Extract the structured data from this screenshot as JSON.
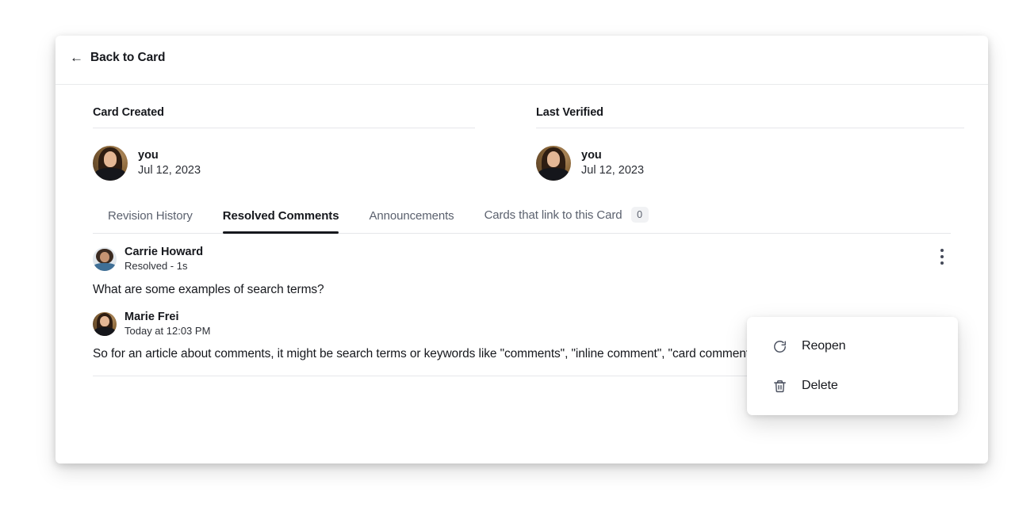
{
  "header": {
    "back_label": "Back to Card",
    "back_arrow": "←",
    "back_icon": "arrow-left-icon"
  },
  "meta": {
    "created": {
      "title": "Card Created",
      "who": "you",
      "date": "Jul 12, 2023"
    },
    "verified": {
      "title": "Last Verified",
      "who": "you",
      "date": "Jul 12, 2023"
    }
  },
  "tabs": [
    {
      "label": "Revision History",
      "active": false,
      "badge": null
    },
    {
      "label": "Resolved Comments",
      "active": true,
      "badge": null
    },
    {
      "label": "Announcements",
      "active": false,
      "badge": null
    },
    {
      "label": "Cards that link to this Card",
      "active": false,
      "badge": "0"
    }
  ],
  "comments": [
    {
      "name": "Carrie Howard",
      "sub": "Resolved - 1s",
      "body": "What are some examples of search terms?"
    },
    {
      "name": "Marie Frei",
      "sub": "Today at 12:03 PM",
      "body": "So for an article about comments, it might be search terms or keywords like \"comments\", \"inline comment\", \"card comment\", etc."
    }
  ],
  "kebab": {
    "icon": "more-vertical-icon"
  },
  "menu": {
    "items": [
      {
        "label": "Reopen",
        "icon": "refresh-cw-icon"
      },
      {
        "label": "Delete",
        "icon": "trash-icon"
      }
    ]
  },
  "colors": {
    "text_primary": "#16181d",
    "text_muted": "#5b616e",
    "divider": "#e6e7ea",
    "badge_bg": "#f1f2f4",
    "accent_underline": "#16181d",
    "page_bg": "#ffffff"
  }
}
